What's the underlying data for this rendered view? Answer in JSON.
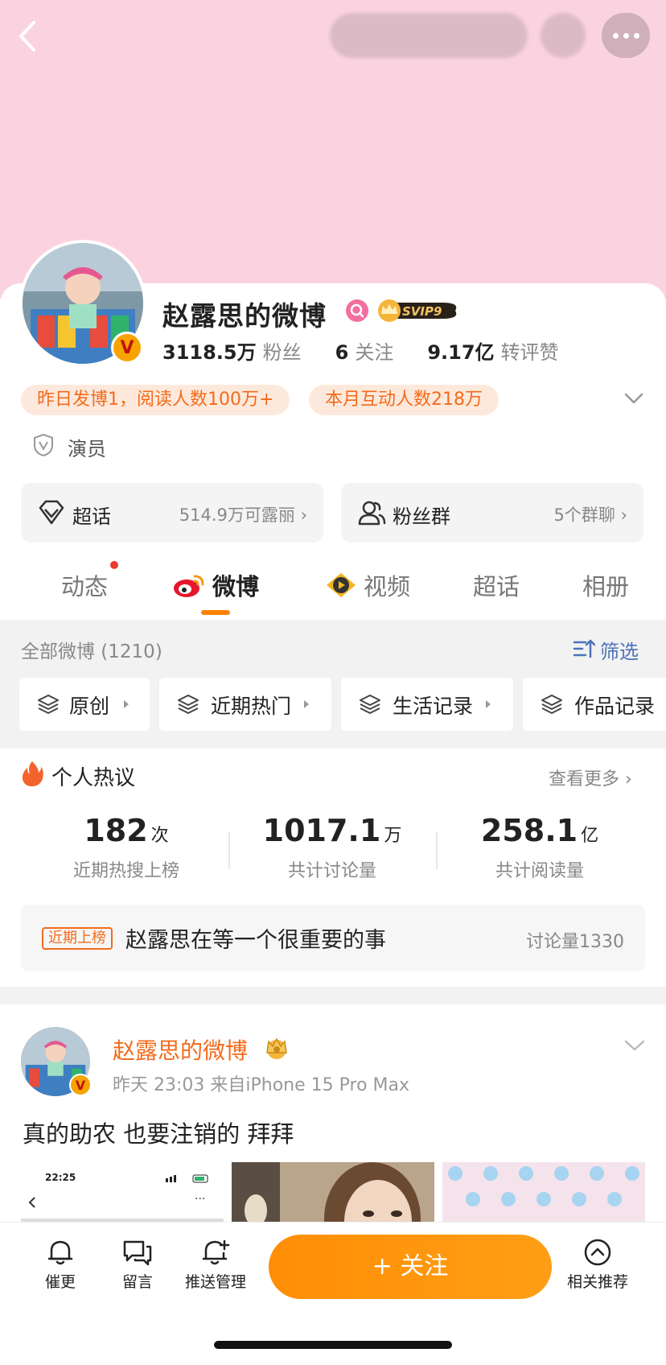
{
  "profile": {
    "name": "赵露思的微博",
    "svip": "SVIP9",
    "fans_count": "3118.5万",
    "fans_label": "粉丝",
    "following_count": "6",
    "following_label": "关注",
    "likes_count": "9.17亿",
    "likes_label": "转评赞",
    "pill_yesterday": "昨日发博1，阅读人数100万+",
    "pill_month": "本月互动人数218万",
    "occupation": "演员",
    "verified_badge": "V"
  },
  "entries": {
    "supertopic": {
      "label": "超话",
      "value": "514.9万可露丽"
    },
    "fan_group": {
      "label": "粉丝群",
      "value": "5个群聊"
    }
  },
  "tabs": [
    {
      "label": "动态"
    },
    {
      "label": "微博",
      "active": true
    },
    {
      "label": "视频"
    },
    {
      "label": "超话"
    },
    {
      "label": "相册"
    }
  ],
  "filter": {
    "title": "全部微博 (1210)",
    "button": "筛选",
    "chips": [
      "原创",
      "近期热门",
      "生活记录",
      "作品记录"
    ]
  },
  "hot": {
    "title": "个人热议",
    "more": "查看更多",
    "metrics": [
      {
        "value": "182",
        "unit": "次",
        "label": "近期热搜上榜"
      },
      {
        "value": "1017.1",
        "unit": "万",
        "label": "共计讨论量"
      },
      {
        "value": "258.1",
        "unit": "亿",
        "label": "共计阅读量"
      }
    ],
    "tag": "近期上榜",
    "topic": "赵露思在等一个很重要的事",
    "count": "讨论量1330"
  },
  "post": {
    "author": "赵露思的微博",
    "meta": "昨天 23:03  来自iPhone 15 Pro Max",
    "text": "真的助农 也要注销的 拜拜",
    "thumb1_time": "22:25"
  },
  "bottom": {
    "remind": "催更",
    "message": "留言",
    "push": "推送管理",
    "follow": "+ 关注",
    "related": "相关推荐"
  },
  "colors": {
    "accent": "#ff8200",
    "banner": "#fbd3e0",
    "pill_bg": "#fde9dc",
    "link_blue": "#4d73b8"
  }
}
